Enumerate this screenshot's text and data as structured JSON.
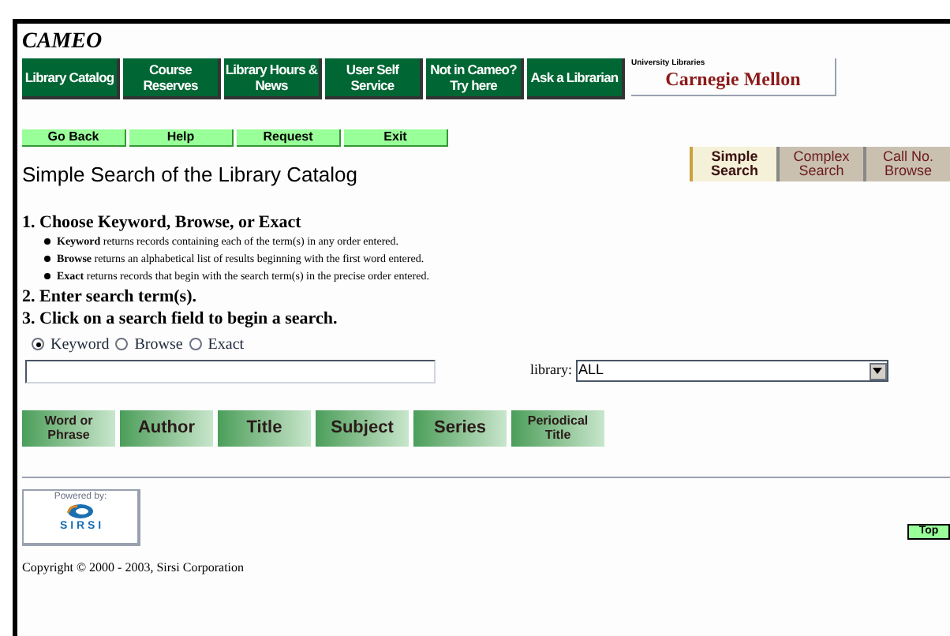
{
  "site_title": "CAMEO",
  "nav": [
    {
      "label": "Library Catalog"
    },
    {
      "label": "Course Reserves"
    },
    {
      "label": "Library Hours & News"
    },
    {
      "label": "User Self Service"
    },
    {
      "label": "Not in Cameo? Try here"
    },
    {
      "label": "Ask a Librarian"
    }
  ],
  "logo": {
    "caption": "University Libraries",
    "name": "Carnegie Mellon"
  },
  "actions": [
    "Go Back",
    "Help",
    "Request",
    "Exit"
  ],
  "page_title": "Simple Search of the Library Catalog",
  "search_tabs": [
    {
      "label": "Simple Search",
      "selected": true
    },
    {
      "label": "Complex Search",
      "selected": false
    },
    {
      "label": "Call No. Browse",
      "selected": false
    }
  ],
  "steps": [
    {
      "text": "1. Choose Keyword, Browse, or Exact",
      "bullets": [
        "**Keyword** returns records containing each of the term(s) in any order entered.",
        "**Browse** returns an alphabetical list of results beginning with the first word entered.",
        "**Exact** returns records that begin with the search term(s) in the precise order entered."
      ]
    },
    {
      "text": "2. Enter search term(s)."
    },
    {
      "text": "3. Click on a search field to begin a search."
    }
  ],
  "modes": [
    {
      "label": "Keyword",
      "selected": true
    },
    {
      "label": "Browse",
      "selected": false
    },
    {
      "label": "Exact",
      "selected": false
    }
  ],
  "library": {
    "label": "library:",
    "value": "ALL"
  },
  "fields": [
    {
      "label": "Word or Phrase"
    },
    {
      "label": "Author"
    },
    {
      "label": "Title"
    },
    {
      "label": "Subject"
    },
    {
      "label": "Series"
    },
    {
      "label": "Periodical Title"
    }
  ],
  "powered": {
    "caption": "Powered by:",
    "name": "S I R S I"
  },
  "top_button": "Top",
  "copyright": "Copyright © 2000 - 2003, Sirsi Corporation"
}
